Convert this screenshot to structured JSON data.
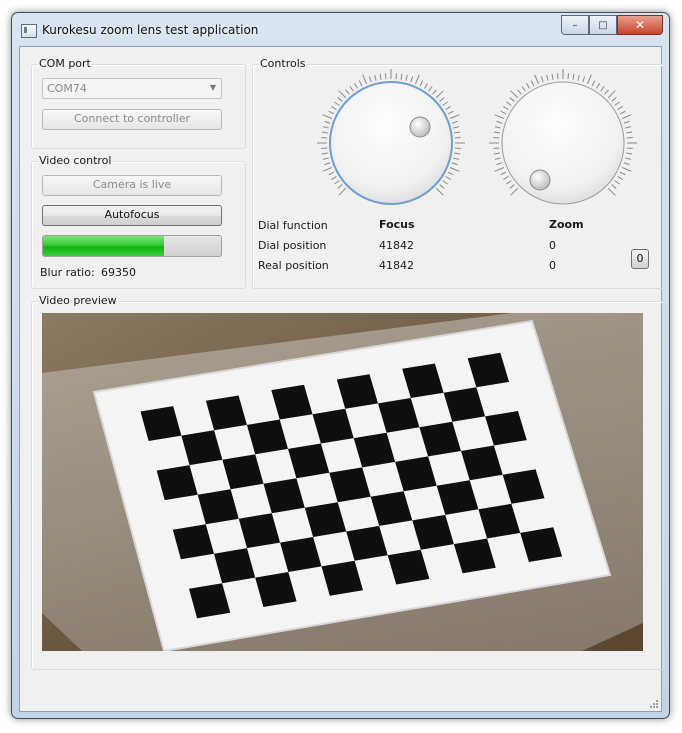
{
  "window": {
    "title": "Kurokesu zoom lens test application"
  },
  "caption": {
    "minimize": "–",
    "maximize": "□",
    "close": "✕"
  },
  "com_port": {
    "group_title": "COM port",
    "selected_port": "COM74",
    "connect_label": "Connect to controller"
  },
  "video_control": {
    "group_title": "Video control",
    "camera_label": "Camera is live",
    "autofocus_label": "Autofocus",
    "blur_progress_fraction": 0.68,
    "blur_label": "Blur ratio:",
    "blur_value": "69350"
  },
  "controls": {
    "group_title": "Controls",
    "dial_function_label": "Dial function",
    "dial_position_label": "Dial position",
    "real_position_label": "Real position",
    "focus": {
      "name": "Focus",
      "dial_position": "41842",
      "real_position": "41842"
    },
    "zoom": {
      "name": "Zoom",
      "dial_position": "0",
      "real_position": "0"
    },
    "reset_label": "0"
  },
  "video_preview": {
    "group_title": "Video preview"
  },
  "colors": {
    "window_frame": "#c3d4e8",
    "client_bg": "#f0f0f0",
    "progress_green": "#1cb81c",
    "close_button": "#c5452c",
    "dial_focus_ring": "#6f9fd0"
  }
}
